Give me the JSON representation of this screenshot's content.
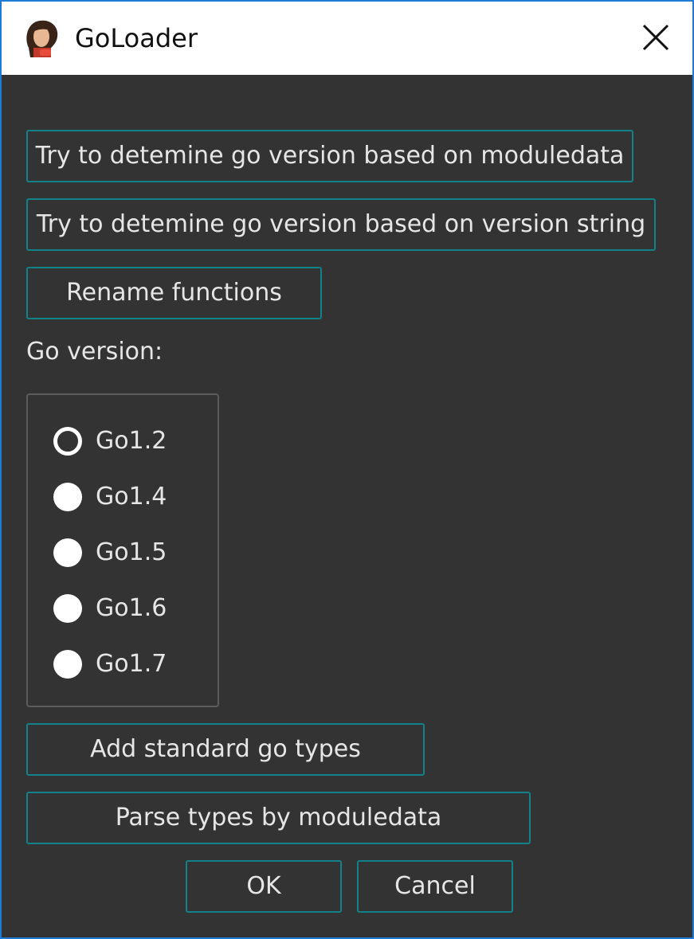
{
  "window": {
    "title": "GoLoader",
    "app_icon": "app-portrait-icon",
    "close_icon": "close-icon"
  },
  "buttons": {
    "detect_moduledata": "Try to detemine go version based on moduledata",
    "detect_version_string": "Try to detemine go version based on version string",
    "rename_functions": "Rename functions",
    "add_standard_types": "Add standard go types",
    "parse_types": "Parse types by moduledata",
    "ok": "OK",
    "cancel": "Cancel"
  },
  "go_version": {
    "label": "Go version:",
    "selected": "Go1.2",
    "options": [
      {
        "label": "Go1.2",
        "checked": true
      },
      {
        "label": "Go1.4",
        "checked": false
      },
      {
        "label": "Go1.5",
        "checked": false
      },
      {
        "label": "Go1.6",
        "checked": false
      },
      {
        "label": "Go1.7",
        "checked": false
      }
    ]
  },
  "colors": {
    "background": "#333333",
    "button_border": "#12828a",
    "text": "#e6e6e6",
    "window_border": "#1e7bd6"
  }
}
